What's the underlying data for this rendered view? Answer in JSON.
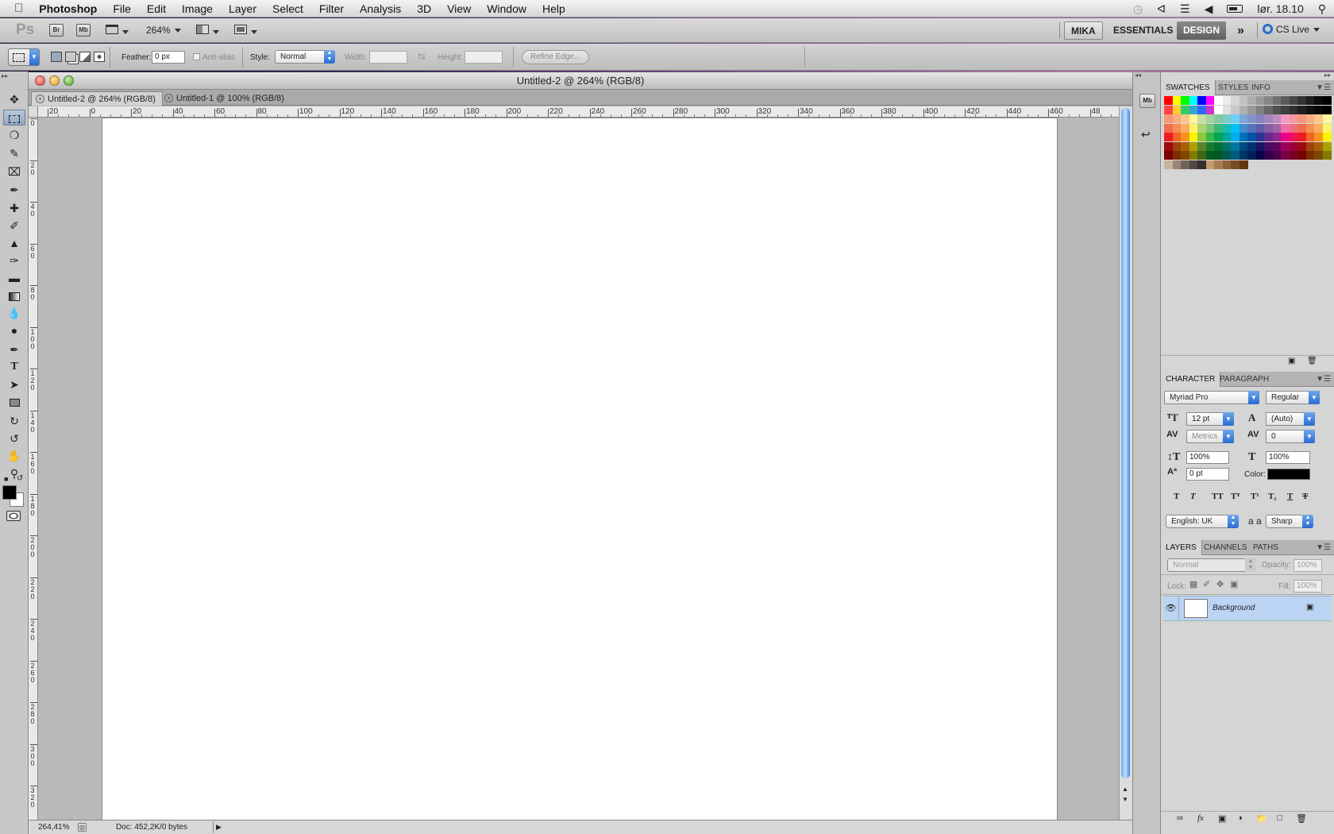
{
  "menubar": {
    "app": "Photoshop",
    "items": [
      "File",
      "Edit",
      "Image",
      "Layer",
      "Select",
      "Filter",
      "Analysis",
      "3D",
      "View",
      "Window",
      "Help"
    ],
    "clock": "lør. 18.10"
  },
  "appbar": {
    "logo": "Ps",
    "br_label": "Br",
    "mb_label": "Mb",
    "zoom": "264%",
    "workspaces": [
      "MIKA",
      "ESSENTIALS",
      "DESIGN"
    ],
    "active_workspace": "DESIGN",
    "more": "»",
    "cslive": "CS Live"
  },
  "options": {
    "feather_label": "Feather:",
    "feather_value": "0 px",
    "antialias_label": "Anti-alias",
    "style_label": "Style:",
    "style_value": "Normal",
    "width_label": "Width:",
    "height_label": "Height:",
    "refine_edge": "Refine Edge..."
  },
  "document": {
    "title": "Untitled-2 @ 264% (RGB/8)",
    "tabs": [
      {
        "label": "Untitled-2 @ 264% (RGB/8)",
        "active": true
      },
      {
        "label": "Untitled-1 @ 100% (RGB/8)",
        "active": false
      }
    ],
    "hruler_ticks": [
      "20",
      "0",
      "20",
      "40",
      "60",
      "80",
      "100",
      "120",
      "140",
      "160",
      "180",
      "200",
      "220",
      "240",
      "260",
      "280",
      "300",
      "320",
      "340",
      "360",
      "380",
      "400",
      "420",
      "440",
      "460",
      "48"
    ],
    "vruler_ticks": [
      "0",
      "20",
      "40",
      "60",
      "80",
      "100",
      "120",
      "140",
      "160",
      "180",
      "200",
      "220",
      "240",
      "260",
      "280",
      "300",
      "320"
    ],
    "zoom_status": "264,41%",
    "doc_status": "Doc: 452,2K/0 bytes"
  },
  "swatches_panel": {
    "tabs": [
      "SWATCHES",
      "STYLES",
      "INFO"
    ],
    "colors": [
      "#ff0000",
      "#ffff00",
      "#00ff00",
      "#00ffff",
      "#0000ff",
      "#ff00ff",
      "#ffffff",
      "#ebebeb",
      "#d6d6d6",
      "#c2c2c2",
      "#adadad",
      "#999999",
      "#858585",
      "#707070",
      "#5c5c5c",
      "#474747",
      "#333333",
      "#1f1f1f",
      "#0a0a0a",
      "#000000",
      "#ff4444",
      "#ffcc33",
      "#33cc66",
      "#33aacc",
      "#3366ff",
      "#cc33cc",
      "#ffffff",
      "#e0e0e0",
      "#c8c8c8",
      "#b0b0b0",
      "#989898",
      "#808080",
      "#686868",
      "#505050",
      "#404040",
      "#303030",
      "#202020",
      "#101010",
      "#080808",
      "#000000",
      "#f7977a",
      "#f9ad81",
      "#fdc68a",
      "#fff79a",
      "#c4df9b",
      "#a2d39c",
      "#82ca9d",
      "#7bcdc8",
      "#6ecff6",
      "#7ea7d8",
      "#8493ca",
      "#8882be",
      "#a187be",
      "#bc8dbf",
      "#f49ac2",
      "#f6989d",
      "#f7977a",
      "#f9ad81",
      "#fdc68a",
      "#fff79a",
      "#f26c4f",
      "#f68e55",
      "#fbaf5c",
      "#fff467",
      "#acd372",
      "#7cc576",
      "#3bb878",
      "#1abbb4",
      "#00bff3",
      "#438ccb",
      "#5574b9",
      "#605ca8",
      "#855fa8",
      "#a763a8",
      "#f06ea9",
      "#f26d7d",
      "#f26c4f",
      "#f68e55",
      "#fbaf5c",
      "#fff467",
      "#ed1c24",
      "#f26522",
      "#f7941d",
      "#fff200",
      "#8dc63f",
      "#39b54a",
      "#00a651",
      "#00a99d",
      "#00aeef",
      "#0072bc",
      "#0054a6",
      "#2e3192",
      "#662d91",
      "#92278f",
      "#ec008c",
      "#ed145b",
      "#ed1c24",
      "#f26522",
      "#f7941d",
      "#fff200",
      "#9e0b0f",
      "#a0410d",
      "#a36209",
      "#aba000",
      "#598527",
      "#1a7b30",
      "#007236",
      "#00746b",
      "#0076a3",
      "#004b80",
      "#003471",
      "#1b1464",
      "#440e62",
      "#630460",
      "#9e005d",
      "#9e0039",
      "#9e0b0f",
      "#a0410d",
      "#a36209",
      "#aba000",
      "#790000",
      "#7b2e00",
      "#7d4900",
      "#827b00",
      "#406618",
      "#005e20",
      "#005826",
      "#005952",
      "#005b7f",
      "#003663",
      "#002157",
      "#0d004c",
      "#32004b",
      "#4b0049",
      "#7b0046",
      "#7a0026",
      "#790000",
      "#7b2e00",
      "#7d4900",
      "#827b00",
      "#c7b299",
      "#998675",
      "#736357",
      "#534741",
      "#37302a",
      "#c69c6d",
      "#a67c52",
      "#8c6239",
      "#754c24",
      "#603913"
    ]
  },
  "character_panel": {
    "tabs": [
      "CHARACTER",
      "PARAGRAPH"
    ],
    "font_family": "Myriad Pro",
    "font_style": "Regular",
    "size": "12 pt",
    "leading": "(Auto)",
    "kerning": "Metrics",
    "tracking": "0",
    "vscale": "100%",
    "hscale": "100%",
    "baseline": "0 pt",
    "color_label": "Color:",
    "language": "English: UK",
    "aa_label": "a a",
    "antialias": "Sharp"
  },
  "layers_panel": {
    "tabs": [
      "LAYERS",
      "CHANNELS",
      "PATHS"
    ],
    "blend_mode": "Normal",
    "opacity_label": "Opacity:",
    "opacity": "100%",
    "lock_label": "Lock:",
    "fill_label": "Fill:",
    "fill": "100%",
    "layers": [
      {
        "name": "Background",
        "locked": true,
        "visible": true
      }
    ]
  },
  "colors": {
    "accent_blue": "#2a6bd3",
    "foreground": "#000000",
    "background": "#ffffff"
  }
}
